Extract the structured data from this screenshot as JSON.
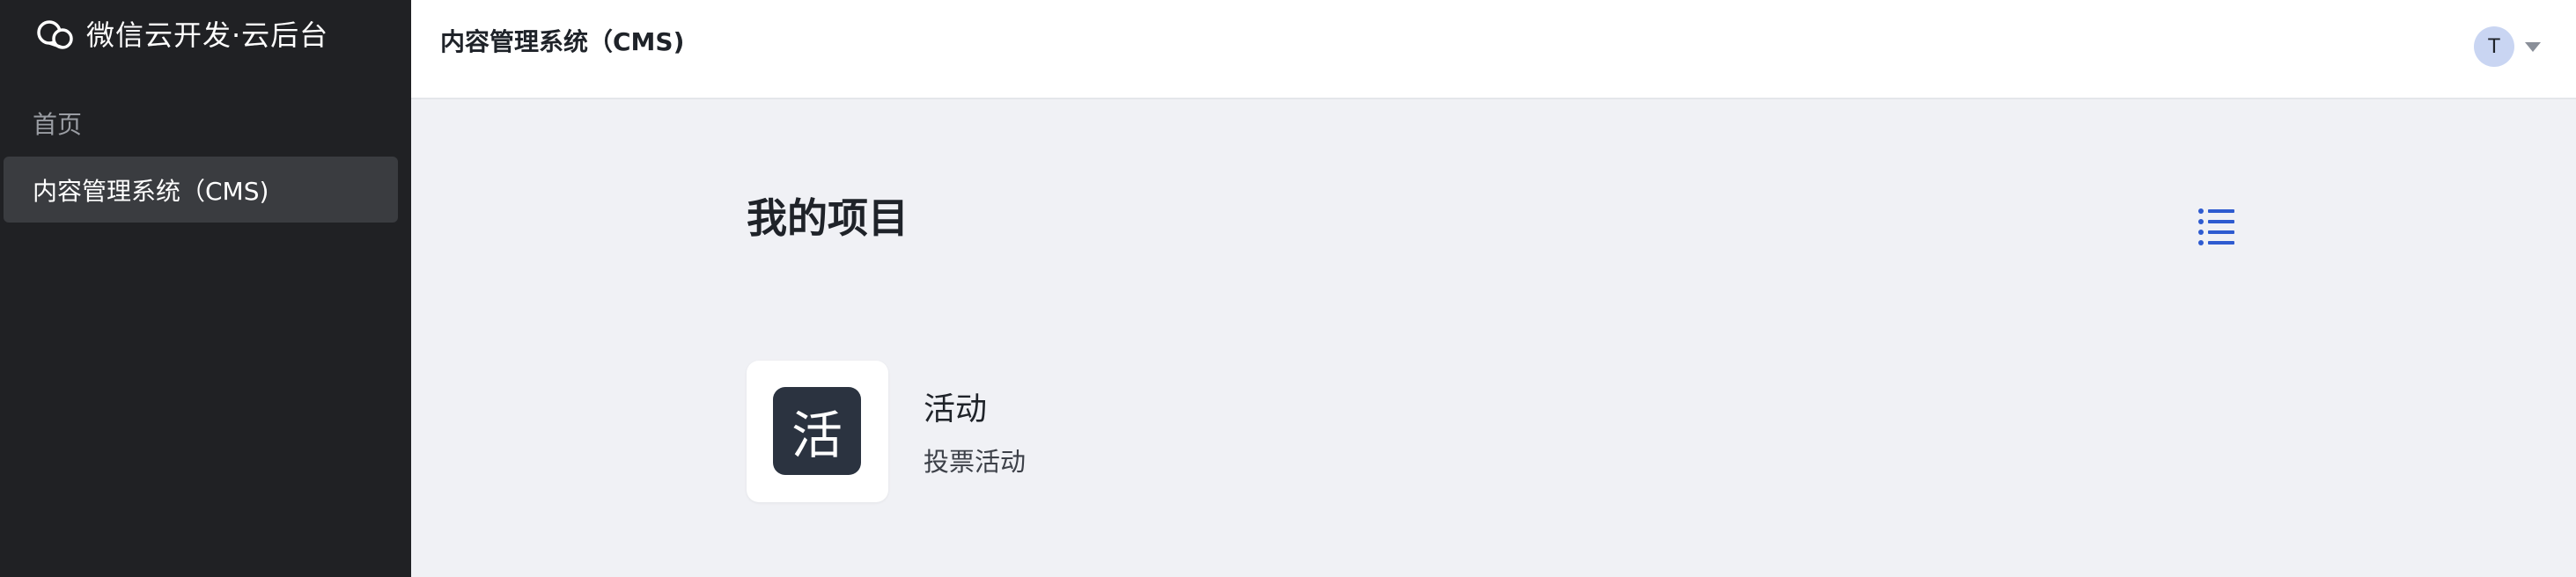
{
  "sidebar": {
    "brand_name": "微信云开发·云后台",
    "brand_icon": "cloud-icon",
    "nav_home": "首页",
    "nav_active": "内容管理系统（CMS)"
  },
  "header": {
    "title": "内容管理系统（CMS)",
    "user_initial": "T",
    "dropdown_icon": "caret-down-icon"
  },
  "main": {
    "title": "我的项目",
    "view_toggle_icon": "list-icon",
    "projects": [
      {
        "icon_char": "活",
        "name": "活动",
        "description": "投票活动"
      }
    ]
  },
  "colors": {
    "sidebar_bg": "#202124",
    "sidebar_active_bg": "#3a3c40",
    "main_bg": "#f0f1f5",
    "accent": "#2e5bd0",
    "avatar_bg": "#c9d5f2",
    "project_icon_bg": "#2b3340"
  }
}
